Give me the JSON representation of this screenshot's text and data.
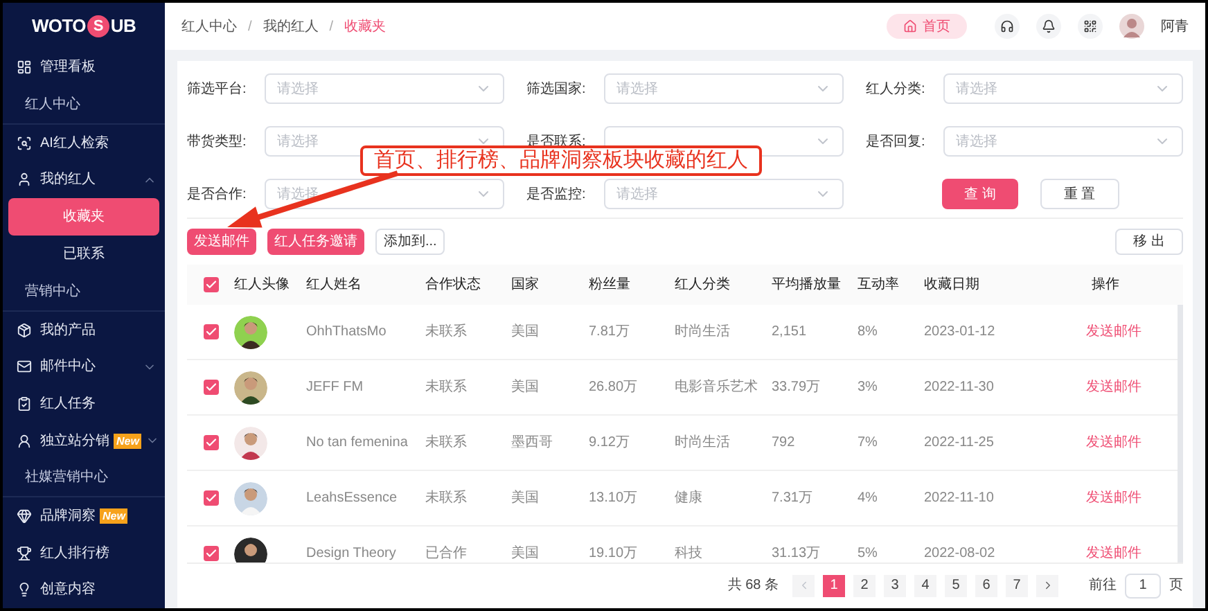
{
  "sidebar": {
    "logo": {
      "before": "WOTO",
      "mark": "S",
      "after": "UB"
    },
    "items": [
      {
        "kind": "item",
        "label": "管理看板",
        "selected": false
      },
      {
        "kind": "section",
        "label": "红人中心"
      },
      {
        "kind": "item",
        "label": "AI红人检索",
        "selected": false
      },
      {
        "kind": "item",
        "label": "我的红人",
        "selected": false,
        "expanded": true,
        "children": [
          {
            "label": "收藏夹",
            "selected": true
          },
          {
            "label": "已联系",
            "selected": false
          }
        ]
      },
      {
        "kind": "section",
        "label": "营销中心"
      },
      {
        "kind": "item",
        "label": "我的产品",
        "selected": false
      },
      {
        "kind": "item",
        "label": "邮件中心",
        "selected": false,
        "expanded": false
      },
      {
        "kind": "item",
        "label": "红人任务",
        "selected": false
      },
      {
        "kind": "item",
        "label": "独立站分销",
        "badge": "New",
        "selected": false,
        "expanded": false
      },
      {
        "kind": "section",
        "label": "社媒营销中心"
      },
      {
        "kind": "item",
        "label": "品牌洞察",
        "badge": "New",
        "selected": false
      },
      {
        "kind": "item",
        "label": "红人排行榜",
        "selected": false
      },
      {
        "kind": "item",
        "label": "创意内容",
        "selected": false
      }
    ]
  },
  "header": {
    "breadcrumb": [
      {
        "label": "红人中心",
        "selected": false
      },
      {
        "label": "我的红人",
        "selected": false
      },
      {
        "label": "收藏夹",
        "selected": true
      }
    ],
    "separator": "/",
    "home": "首页",
    "user": "阿青"
  },
  "filters": [
    {
      "label": "筛选平台:",
      "placeholder": "请选择"
    },
    {
      "label": "筛选国家:",
      "placeholder": "请选择"
    },
    {
      "label": "红人分类:",
      "placeholder": "请选择"
    },
    {
      "label": "带货类型:",
      "placeholder": "请选择"
    },
    {
      "label": "是否联系:"
    },
    {
      "label": "是否回复:",
      "placeholder": "请选择"
    },
    {
      "label": "是否合作:",
      "placeholder": "请选择"
    },
    {
      "label": "是否监控:",
      "placeholder": "请选择"
    }
  ],
  "filter_buttons": [
    "查 询",
    "重 置"
  ],
  "actions": [
    "发送邮件",
    "红人任务邀请",
    "添加到..."
  ],
  "remove": "移 出",
  "annotation": "首页、排行榜、品牌洞察板块收藏的红人",
  "table": {
    "all_checked": true,
    "columns": [
      "红人头像",
      "红人姓名",
      "合作状态",
      "国家",
      "粉丝量",
      "红人分类",
      "平均播放量",
      "互动率",
      "收藏日期",
      "操作"
    ],
    "rows": [
      {
        "checked": true,
        "name": "OhhThatsMo",
        "status": "未联系",
        "country": "美国",
        "fans": "7.81万",
        "category": "时尚生活",
        "avg_views": "2,151",
        "rate": "8%",
        "date": "2023-01-12",
        "action": "发送邮件"
      },
      {
        "checked": true,
        "name": "JEFF FM",
        "status": "未联系",
        "country": "美国",
        "fans": "26.80万",
        "category": "电影音乐艺术",
        "avg_views": "33.79万",
        "rate": "3%",
        "date": "2022-11-30",
        "action": "发送邮件"
      },
      {
        "checked": true,
        "name": "No tan femenina",
        "status": "未联系",
        "country": "墨西哥",
        "fans": "9.12万",
        "category": "时尚生活",
        "avg_views": "792",
        "rate": "7%",
        "date": "2022-11-25",
        "action": "发送邮件"
      },
      {
        "checked": true,
        "name": "LeahsEssence",
        "status": "未联系",
        "country": "美国",
        "fans": "13.10万",
        "category": "健康",
        "avg_views": "7.31万",
        "rate": "4%",
        "date": "2022-11-10",
        "action": "发送邮件"
      },
      {
        "checked": true,
        "name": "Design Theory",
        "status": "已合作",
        "country": "美国",
        "fans": "19.10万",
        "category": "科技",
        "avg_views": "31.13万",
        "rate": "5%",
        "date": "2022-08-02",
        "action": "发送邮件"
      }
    ]
  },
  "pagination": {
    "total": "共 68 条",
    "pages": [
      {
        "label": "1",
        "selected": true
      },
      {
        "label": "2",
        "selected": false
      },
      {
        "label": "3",
        "selected": false
      },
      {
        "label": "4",
        "selected": false
      },
      {
        "label": "5",
        "selected": false
      },
      {
        "label": "6",
        "selected": false
      },
      {
        "label": "7",
        "selected": false
      }
    ],
    "goto": "前往",
    "page_value": "1",
    "page_unit": "页"
  }
}
